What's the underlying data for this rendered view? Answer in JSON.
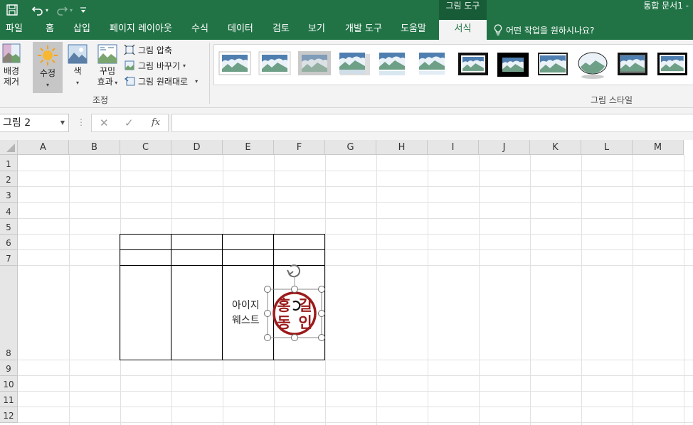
{
  "app": {
    "document_title": "통합 문서1 -",
    "context_group": "그림 도구"
  },
  "tabs": [
    {
      "label": "파일",
      "name": "tab-file"
    },
    {
      "label": "홈",
      "name": "tab-home"
    },
    {
      "label": "삽입",
      "name": "tab-insert"
    },
    {
      "label": "페이지 레이아웃",
      "name": "tab-page-layout"
    },
    {
      "label": "수식",
      "name": "tab-formulas"
    },
    {
      "label": "데이터",
      "name": "tab-data"
    },
    {
      "label": "검토",
      "name": "tab-review"
    },
    {
      "label": "보기",
      "name": "tab-view"
    },
    {
      "label": "개발 도구",
      "name": "tab-developer"
    },
    {
      "label": "도움말",
      "name": "tab-help"
    },
    {
      "label": "서식",
      "name": "tab-format",
      "active": true
    }
  ],
  "tell_me": "어떤 작업을 원하시나요?",
  "ribbon": {
    "remove_bg_line1": "배경",
    "remove_bg_line2": "제거",
    "corrections": "수정",
    "color": "색",
    "artistic_line1": "꾸밈",
    "artistic_line2": "효과",
    "compress": "그림 압축",
    "change": "그림 바꾸기",
    "reset": "그림 원래대로",
    "adjust_group": "조정",
    "styles_group": "그림 스타일"
  },
  "formula_bar": {
    "name_box": "그림 2",
    "cancel_icon": "x-icon",
    "enter_icon": "check-icon",
    "fx": "fx",
    "formula": ""
  },
  "columns": [
    "A",
    "B",
    "C",
    "D",
    "E",
    "F",
    "G",
    "H",
    "I",
    "J",
    "K",
    "L",
    "M"
  ],
  "rows": [
    "1",
    "2",
    "3",
    "4",
    "5",
    "6",
    "7",
    "8",
    "9",
    "10",
    "11",
    "12"
  ],
  "cells": {
    "E8_line1": "아이지",
    "E8_line2": "웨스트"
  },
  "picture": {
    "seal_text": "홍길동인",
    "seal_color": "#9b1b1b",
    "selected": true
  },
  "colors": {
    "excel_green": "#217346",
    "context_green": "#185c37",
    "ribbon_bg": "#f3f3f3"
  }
}
